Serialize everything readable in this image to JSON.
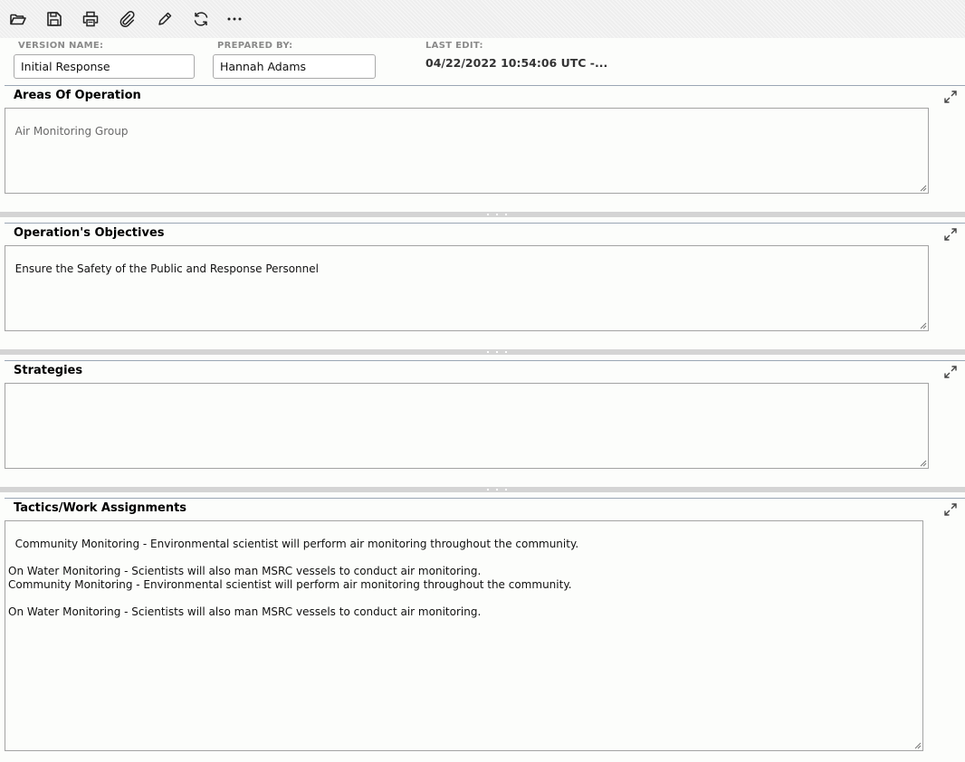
{
  "toolbar": {
    "buttons": [
      {
        "icon": "folder-open-icon"
      },
      {
        "icon": "save-icon"
      },
      {
        "icon": "print-icon"
      },
      {
        "icon": "paperclip-icon"
      },
      {
        "icon": "pencil-icon"
      },
      {
        "icon": "refresh-icon"
      },
      {
        "icon": "more-icon"
      }
    ]
  },
  "meta": {
    "version_name_label": "VERSION NAME:",
    "version_name_value": "Initial Response",
    "prepared_by_label": "PREPARED BY:",
    "prepared_by_value": "Hannah Adams",
    "last_edit_label": "LAST EDIT:",
    "last_edit_value": "04/22/2022 10:54:06 UTC -..."
  },
  "sections": {
    "areas": {
      "title": "Areas Of Operation",
      "text": "Air Monitoring Group"
    },
    "objectives": {
      "title": "Operation's Objectives",
      "text": "Ensure the Safety of the Public and Response Personnel"
    },
    "strategies": {
      "title": "Strategies",
      "text": ""
    },
    "tactics": {
      "title": "Tactics/Work Assignments",
      "text": "Community Monitoring - Environmental scientist will perform air monitoring throughout the community.\n\nOn Water Monitoring - Scientists will also man MSRC vessels to conduct air monitoring.\nCommunity Monitoring - Environmental scientist will perform air monitoring throughout the community.\n\nOn Water Monitoring - Scientists will also man MSRC vessels to conduct air monitoring."
    }
  }
}
